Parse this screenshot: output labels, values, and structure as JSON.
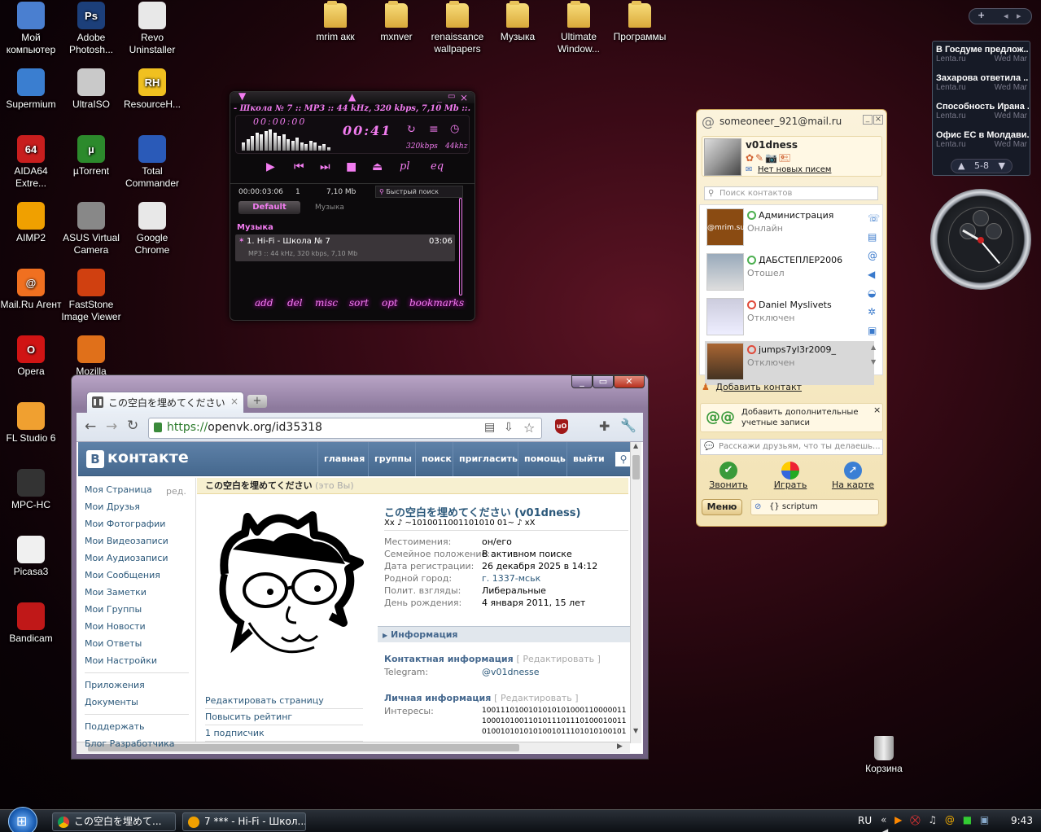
{
  "desktop": {
    "icons": [
      {
        "label": "Мой компьютер",
        "icon": "computer-icon"
      },
      {
        "label": "Adobe Photosh...",
        "icon": "photoshop-icon",
        "badge": "Ps"
      },
      {
        "label": "Revo Uninstaller",
        "icon": "revo-icon"
      },
      {
        "label": "Supermium",
        "icon": "supermium-icon"
      },
      {
        "label": "UltraISO",
        "icon": "ultraiso-icon"
      },
      {
        "label": "ResourceH...",
        "icon": "resourcehacker-icon",
        "badge": "RH"
      },
      {
        "label": "AIDA64 Extre...",
        "icon": "aida64-icon",
        "badge": "64"
      },
      {
        "label": "µTorrent",
        "icon": "utorrent-icon",
        "badge": "µ"
      },
      {
        "label": "Total Commander",
        "icon": "totalcommander-icon"
      },
      {
        "label": "AIMP2",
        "icon": "aimp-icon"
      },
      {
        "label": "ASUS Virtual Camera",
        "icon": "camera-icon"
      },
      {
        "label": "Google Chrome",
        "icon": "chrome-icon"
      },
      {
        "label": "Mail.Ru Агент",
        "icon": "mailru-agent-icon",
        "badge": "@"
      },
      {
        "label": "FastStone Image Viewer",
        "icon": "faststone-icon"
      },
      {
        "label": "Opera",
        "icon": "opera-icon",
        "badge": "O"
      },
      {
        "label": "Mozilla",
        "icon": "firefox-icon"
      },
      {
        "label": "FL Studio 6",
        "icon": "flstudio-icon"
      },
      {
        "label": "MPC-HC",
        "icon": "mpc-icon"
      },
      {
        "label": "Picasa3",
        "icon": "picasa-icon"
      },
      {
        "label": "Bandicam",
        "icon": "bandicam-icon"
      }
    ],
    "folders": [
      {
        "label": "mrim акк"
      },
      {
        "label": "mxnver"
      },
      {
        "label": "renaissance wallpapers"
      },
      {
        "label": "Музыка"
      },
      {
        "label": "Ultimate Window..."
      },
      {
        "label": "Программы"
      }
    ],
    "recycle_bin": "Корзина"
  },
  "player": {
    "title": "- Школа № 7 :: MP3 :: 44 kHz, 320 kbps, 7,10 Mb ::.",
    "elapsed_display": "00:00:00",
    "time": "00:41",
    "bitrate": "320kbps",
    "samplerate": "44khz",
    "buttons": [
      "pl",
      "eq"
    ],
    "length_total": "00:00:03:06",
    "count": "1",
    "size": "7,10 Mb",
    "search_label": "Быстрый поиск",
    "tabs": [
      "Default",
      "Музыка"
    ],
    "group": "Музыка",
    "track": {
      "title": "1. Hi-Fi - Школа № 7",
      "duration": "03:06",
      "info": "MP3 :: 44 kHz, 320 kbps, 7,10 Mb"
    },
    "bottom_menu": [
      "add",
      "del",
      "misc",
      "sort",
      "opt",
      "bookmarks"
    ]
  },
  "chrome": {
    "tab_title": "この空白を埋めてください",
    "new_tab": "+",
    "url": "https://openvk.org/id35318",
    "url_scheme": "https://",
    "url_rest": "openvk.org/id35318"
  },
  "vk": {
    "logo": "контакте",
    "logo_b": "В",
    "nav": [
      "главная",
      "группы",
      "поиск",
      "пригласить",
      "помощь",
      "выйти"
    ],
    "menu": [
      "Моя Страница",
      "Мои Друзья",
      "Мои Фотографии",
      "Мои Видеозаписи",
      "Мои Аудиозаписи",
      "Мои Сообщения",
      "Мои Заметки",
      "Мои Группы",
      "Мои Новости",
      "Мои Ответы",
      "Мои Настройки"
    ],
    "menu_edit": "ред.",
    "menu2": [
      "Приложения",
      "Документы"
    ],
    "menu3": [
      "Поддержать",
      "Блог Разработчика"
    ],
    "page_header": "この空白を埋めてください",
    "page_header_note": "(это Вы)",
    "profile_name": "この空白を埋めてください (v01dness)",
    "status": "Xx ♪ ~1010011001101010 01~ ♪ xX",
    "fields": [
      {
        "k": "Местоимения:",
        "v": "он/его"
      },
      {
        "k": "Семейное положение:",
        "v": "В активном поиске"
      },
      {
        "k": "Дата регистрации:",
        "v": "26 декабря 2025 в 14:12"
      },
      {
        "k": "Родной город:",
        "v": "г. 1337-мськ"
      },
      {
        "k": "Полит. взгляды:",
        "v": "Либеральные"
      },
      {
        "k": "День рождения:",
        "v": "4 января 2011, 15 лет"
      }
    ],
    "info_header": "Информация",
    "contact_header": "Контактная информация",
    "edit_link": "[ Редактировать ]",
    "telegram_k": "Telegram:",
    "telegram_v": "@v01dnesse",
    "personal_header": "Личная информация",
    "interests_k": "Интересы:",
    "interests_v": [
      "1001110100101010101000110000011",
      "1000101001101011101110100010011",
      "0100101010101001011101010100101"
    ],
    "left_links": [
      "Редактировать страницу",
      "Повысить рейтинг",
      "1 подписчик"
    ]
  },
  "agent": {
    "account": "someoneer_921@mail.ru",
    "nick": "v01dness",
    "no_mail": "Нет новых писем",
    "search_placeholder": "Поиск контактов",
    "contacts": [
      {
        "name": "Администрация",
        "status": "Онлайн",
        "avatar_text": "@mrim.su"
      },
      {
        "name": "ДАБСТЕПЛЕР2006",
        "status": "Отошел"
      },
      {
        "name": "Daniel Myslivets",
        "status": "Отключен"
      },
      {
        "name": "jumps7yl3r2009_",
        "status": "Отключен"
      }
    ],
    "add_contact": "Добавить контакт",
    "add_accounts": "Добавить дополнительные учетные записи",
    "status_placeholder": "Расскажи друзьям, что ты делаешь...",
    "actions": [
      "Звонить",
      "Играть",
      "На карте"
    ],
    "menu": "Меню",
    "scriptum": "{} scriptum"
  },
  "news": {
    "items": [
      {
        "h": "В Госдуме предлож...",
        "s": "Lenta.ru",
        "d": "Wed Mar"
      },
      {
        "h": "Захарова ответила ...",
        "s": "Lenta.ru",
        "d": "Wed Mar"
      },
      {
        "h": "Способность Ирана ...",
        "s": "Lenta.ru",
        "d": "Wed Mar"
      },
      {
        "h": "Офис ЕС в Молдави...",
        "s": "Lenta.ru",
        "d": "Wed Mar"
      }
    ],
    "pager": "5-8"
  },
  "taskbar": {
    "tasks": [
      "この空白を埋めて...",
      "7 *** - Hi-Fi - Школ..."
    ],
    "lang": "RU",
    "clock": "9:43"
  },
  "colors": {
    "vk_blue": "#45688e",
    "player_pink": "#f27cf0",
    "agent_bg": "#f7ecc8"
  }
}
